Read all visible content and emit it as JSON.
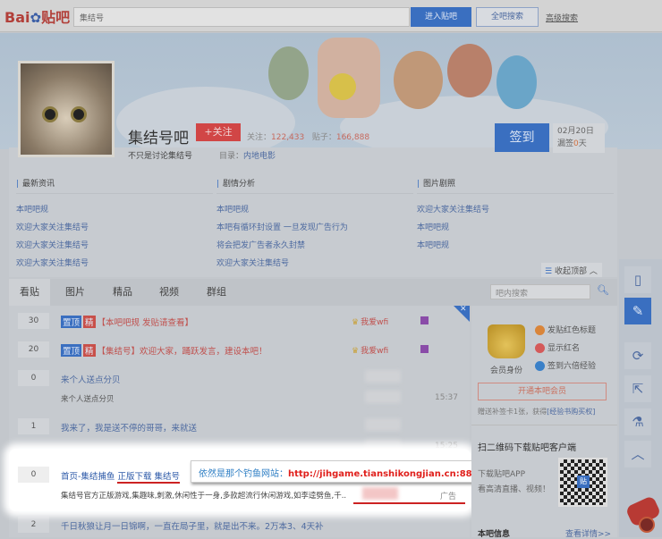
{
  "topbar": {
    "logo": "Bai",
    "logo_paw": "du",
    "logo_suffix": "贴吧",
    "search_value": "集结号",
    "enter_label": "进入贴吧",
    "all_label": "全吧搜索",
    "advanced_label": "高级搜索"
  },
  "forum": {
    "title": "集结号吧",
    "follow_label": "+关注",
    "follow_prefix": "关注：",
    "follow_count": "122,433",
    "posts_prefix": "贴子：",
    "posts_count": "166,888",
    "slogan": "不只是讨论集结号",
    "category_prefix": "目录：",
    "category": "内地电影",
    "sign_label": "签到",
    "sign_date": "02月20日",
    "sign_streak_prefix": "漏签",
    "sign_streak": "0",
    "sign_streak_suffix": "天"
  },
  "columns": [
    {
      "title": "最新资讯",
      "items": [
        "本吧吧规",
        "欢迎大家关注集结号",
        "欢迎大家关注集结号",
        "欢迎大家关注集结号"
      ]
    },
    {
      "title": "剧情分析",
      "items": [
        "本吧吧规",
        "本吧有循环封设置 一旦发现广告行为",
        "将会把发广告者永久封禁",
        "欢迎大家关注集结号"
      ]
    },
    {
      "title": "图片剧照",
      "items": [
        "欢迎大家关注集结号",
        "本吧吧规",
        "本吧吧规"
      ]
    }
  ],
  "collapse_label": "收起顶部",
  "tabs": [
    "看贴",
    "图片",
    "精品",
    "视频",
    "群组"
  ],
  "in_search_placeholder": "吧内搜索",
  "threads": [
    {
      "count": "30",
      "title": "【本吧吧规 发贴请查看】",
      "author": "我爱wfi",
      "badges": [
        "置顶",
        "精"
      ]
    },
    {
      "count": "20",
      "title": "【集结号】欢迎大家，踊跃发言，建设本吧！",
      "author": "我爱wfi",
      "badges": [
        "置顶",
        "精"
      ]
    },
    {
      "count": "0",
      "title": "来个人送点分贝",
      "sub": "来个人送点分贝",
      "time": "15:37"
    },
    {
      "count": "1",
      "title": "我来了，我是送不停的哥哥，来就送",
      "time": "15:25"
    },
    {
      "count": "2",
      "title": "千日秋狼让月一日锦啊，一直在局子里，就是出不来。2万本3、4天补"
    }
  ],
  "ad": {
    "count": "0",
    "title_a": "首页-集结捕鱼",
    "title_b": "正版下载 集结号",
    "desc": "集结号官方正版游戏,集趣味,刺激,休闲性于一身,多款超流行休闲游戏,如李逵劈鱼,千...",
    "label": "广告"
  },
  "callout": {
    "label": "依然是那个钓鱼网站：",
    "url": "http://jihgame.tianshikongjian.cn:88"
  },
  "sidebar": {
    "member_label": "会员身份",
    "perks": [
      "发贴红色标题",
      "显示红名",
      "签到六倍经验"
    ],
    "vip_button": "开通本吧会员",
    "vip_note_a": "赠送补签卡1张，获得",
    "vip_note_b": "[经验书购买权]",
    "qr_title": "扫二维码下载贴吧客户端",
    "qr_line1": "下载贴吧APP",
    "qr_line2": "看高清直播、视频！",
    "qr_logo": "贴",
    "info_title": "本吧信息",
    "info_more": "查看详情>>"
  },
  "colors": {
    "accent": "#3a6fc0",
    "red": "#c0504d",
    "callout_url": "#e0201c"
  }
}
